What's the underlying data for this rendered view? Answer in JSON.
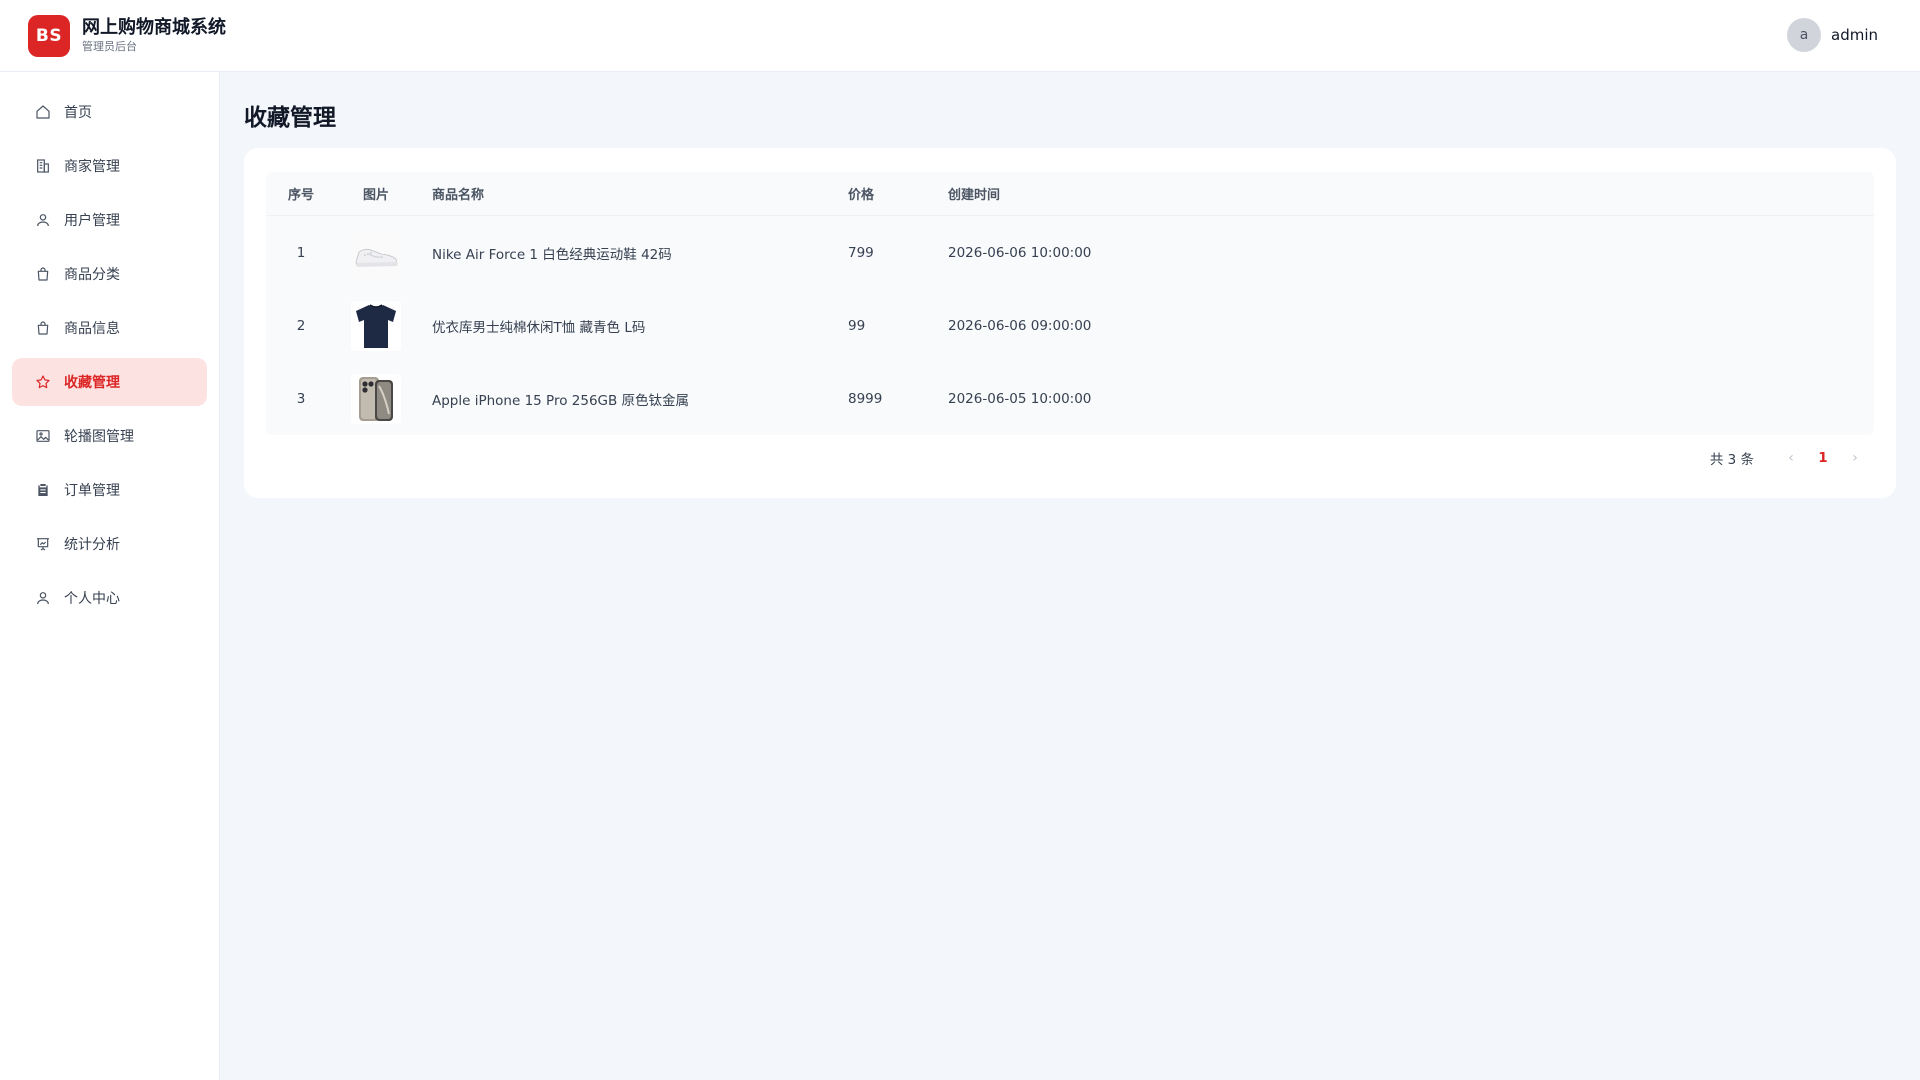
{
  "header": {
    "logo_text": "BS",
    "title": "网上购物商城系统",
    "subtitle": "管理员后台",
    "avatar_letter": "a",
    "username": "admin"
  },
  "sidebar": {
    "items": [
      {
        "label": "首页",
        "icon": "home-icon"
      },
      {
        "label": "商家管理",
        "icon": "building-icon"
      },
      {
        "label": "用户管理",
        "icon": "user-icon"
      },
      {
        "label": "商品分类",
        "icon": "shopping-bag-icon"
      },
      {
        "label": "商品信息",
        "icon": "shopping-bag-icon"
      },
      {
        "label": "收藏管理",
        "icon": "star-icon",
        "active": true
      },
      {
        "label": "轮播图管理",
        "icon": "image-icon"
      },
      {
        "label": "订单管理",
        "icon": "clipboard-icon"
      },
      {
        "label": "统计分析",
        "icon": "presentation-chart-icon"
      },
      {
        "label": "个人中心",
        "icon": "user-icon"
      }
    ]
  },
  "main": {
    "page_title": "收藏管理",
    "table": {
      "headers": {
        "index": "序号",
        "image": "图片",
        "name": "商品名称",
        "price": "价格",
        "created": "创建时间"
      },
      "rows": [
        {
          "index": "1",
          "image": "white-sneaker",
          "name": "Nike Air Force 1 白色经典运动鞋 42码",
          "price": "799",
          "created": "2026-06-06 10:00:00"
        },
        {
          "index": "2",
          "image": "navy-tshirt",
          "name": "优衣库男士纯棉休闲T恤 藏青色 L码",
          "price": "99",
          "created": "2026-06-06 09:00:00"
        },
        {
          "index": "3",
          "image": "titanium-iphone",
          "name": "Apple iPhone 15 Pro 256GB 原色钛金属",
          "price": "8999",
          "created": "2026-06-05 10:00:00"
        }
      ]
    },
    "pagination": {
      "total_text": "共 3 条",
      "current_page": "1",
      "prev": "‹",
      "next": "›"
    }
  },
  "colors": {
    "accent": "#dc2626",
    "active_bg": "#fde2e2",
    "page_bg": "#f3f6fa"
  }
}
